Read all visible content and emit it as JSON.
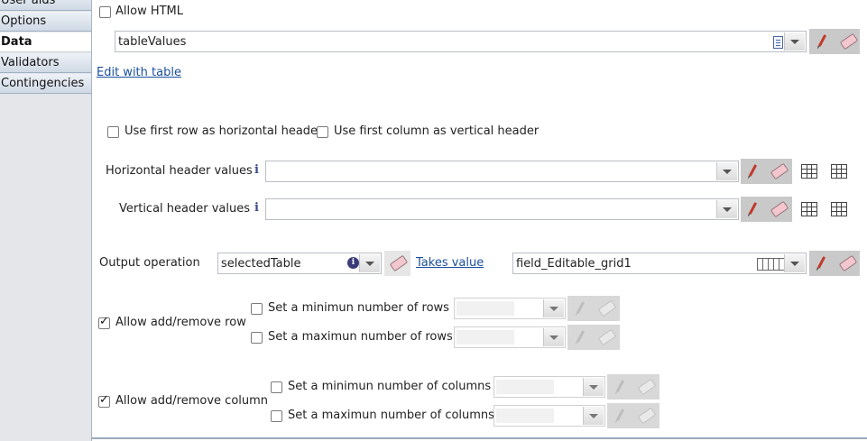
{
  "sidebar": {
    "items": [
      {
        "label": "User aids",
        "active": false
      },
      {
        "label": "Options",
        "active": false
      },
      {
        "label": "Data",
        "active": true
      },
      {
        "label": "Validators",
        "active": false
      },
      {
        "label": "Contingencies",
        "active": false
      }
    ]
  },
  "allow_html": {
    "label": "Allow HTML",
    "checked": false
  },
  "values_field": {
    "value": "tableValues"
  },
  "edit_with_table": {
    "label": "Edit with table"
  },
  "header_options": {
    "first_row_label": "Use first row as horizontal header",
    "first_row_checked": false,
    "first_col_label": "Use first column as vertical header",
    "first_col_checked": false
  },
  "horizontal_header": {
    "label": "Horizontal header values",
    "value": ""
  },
  "vertical_header": {
    "label": "Vertical header values",
    "value": ""
  },
  "output": {
    "label": "Output operation",
    "operation_value": "selectedTable",
    "takes_value_label": "Takes value",
    "target_value": "field_Editable_grid1"
  },
  "rows": {
    "allow_label": "Allow add/remove row",
    "allow_checked": true,
    "min_label": "Set a minimun number of rows",
    "max_label": "Set a maximun number of rows"
  },
  "columns": {
    "allow_label": "Allow add/remove column",
    "allow_checked": true,
    "min_label": "Set a minimun number of columns",
    "max_label": "Set a maximun number of columns"
  },
  "icons": {
    "info": "info-icon",
    "pen": "pencil-icon",
    "eraser": "eraser-icon",
    "grid": "table-grid-icon",
    "dropdown": "chevron-down-icon"
  }
}
